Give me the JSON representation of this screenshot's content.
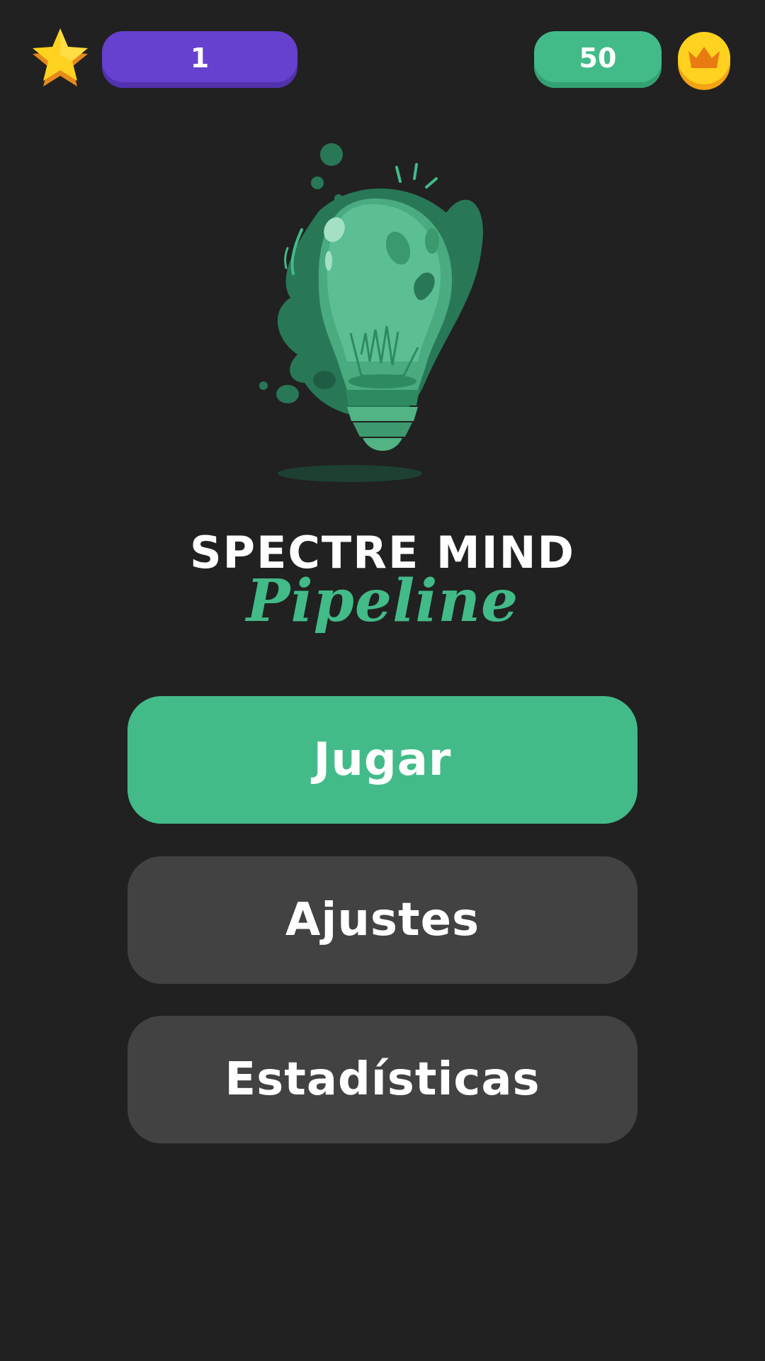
{
  "hud": {
    "level": "1",
    "coins": "50",
    "star_icon": "star-icon",
    "coin_icon": "crown-coin-icon"
  },
  "title": {
    "main": "SPECTRE MIND",
    "sub": "Pipeline"
  },
  "menu": {
    "play_label": "Jugar",
    "settings_label": "Ajustes",
    "stats_label": "Estadísticas"
  },
  "colors": {
    "background": "#212121",
    "accent_green": "#42bb89",
    "level_purple": "#6640cf",
    "button_gray": "#424242",
    "star_yellow": "#ffd21f"
  }
}
